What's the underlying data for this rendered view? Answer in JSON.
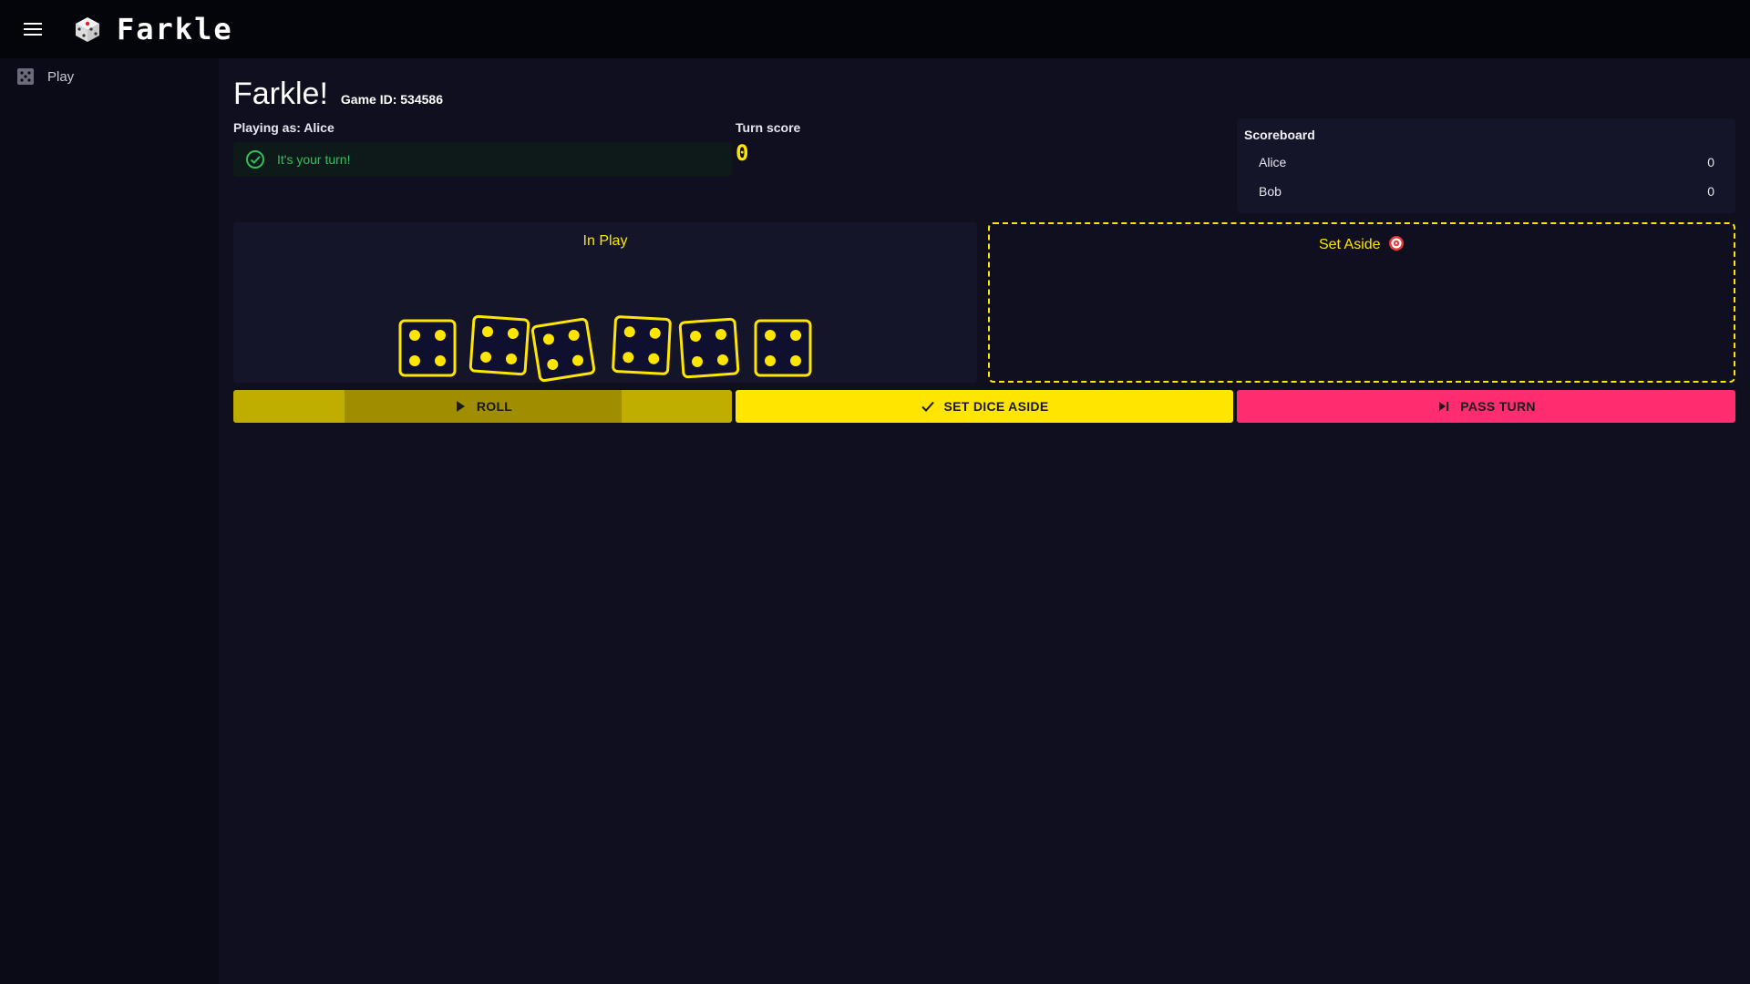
{
  "app": {
    "title": "Farkle",
    "nav": [
      {
        "label": "Play",
        "icon": "dice-grid-icon"
      }
    ]
  },
  "game": {
    "heading": "Farkle!",
    "game_id_label": "Game ID: 534586",
    "playing_as_prefix": "Playing as: ",
    "player_name": "Alice",
    "status_message": "It's your turn!",
    "turn_score_label": "Turn score",
    "turn_score": 0
  },
  "scoreboard": {
    "title": "Scoreboard",
    "rows": [
      {
        "name": "Alice",
        "score": "0"
      },
      {
        "name": "Bob",
        "score": "0"
      }
    ]
  },
  "panels": {
    "in_play_title": "In Play",
    "set_aside_title": "Set Aside",
    "set_aside_icon": "target-icon"
  },
  "dice_in_play": [
    4,
    4,
    4,
    4,
    4,
    4
  ],
  "actions": {
    "roll": "ROLL",
    "set_aside": "SET DICE ASIDE",
    "pass": "PASS TURN"
  },
  "colors": {
    "accent": "#ffe600",
    "pass": "#ff2d6f",
    "success": "#2fbf5e",
    "background": "#0f0f1f"
  }
}
